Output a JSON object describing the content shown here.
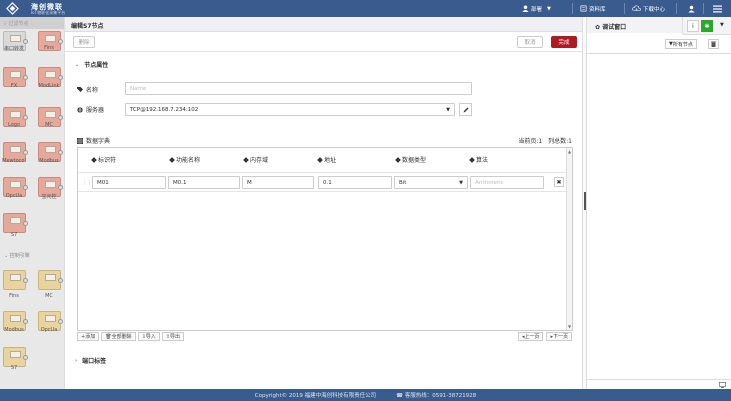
{
  "brand": {
    "title": "海创微联",
    "subtitle": "IoT物联化采集平台"
  },
  "nav": {
    "user": "部署",
    "resources": "资料库",
    "download": "下载中心"
  },
  "palette": {
    "search_placeholder": "过滤节点",
    "nodes_top": [
      "串口转发",
      "Fins",
      "FX",
      "ModLink",
      "Logo",
      "MC",
      "Mewtocol",
      "Modbus",
      "OpcUa",
      "宝元控",
      "S7"
    ],
    "section": "控制引擎",
    "nodes_bottom": [
      "Fins",
      "MC",
      "Modbus",
      "OpcUa",
      "S7"
    ]
  },
  "editor": {
    "title": "编辑S7节点",
    "delete_label": "删除",
    "cancel_label": "取消",
    "done_label": "完成",
    "props_title": "节点属性",
    "name_label": "名称",
    "name_placeholder": "Name",
    "server_label": "服务器",
    "server_value": "TCP@192.168.7.234:102",
    "dict_title": "数据字典",
    "current_page": "当前页:1",
    "total_count": "列总数:1",
    "columns": [
      "标识符",
      "功能名称",
      "内存域",
      "地址",
      "数据类型",
      "算法"
    ],
    "row": {
      "identifier": "M01",
      "function": "M0.1",
      "memory": "M",
      "address": "0.1",
      "datatype": "Bit",
      "algorithm_placeholder": "Arithmetic"
    },
    "actions": [
      "添加",
      "全部删除",
      "导入",
      "导出"
    ],
    "prev_page": "上一页",
    "next_page": "下一页",
    "port_title": "端口标签"
  },
  "debug": {
    "tab_label": "调试窗口",
    "filter_label": "所有节点"
  },
  "footer": {
    "copyright": "Copyright© 2019 福建中海创科技有限责任公司",
    "hotline": "客服热线：0591-38721928"
  },
  "colors": {
    "header": "#3a5b8e",
    "primary": "#ad1c22",
    "node": "#e6a89b",
    "success": "#2ba82b"
  }
}
